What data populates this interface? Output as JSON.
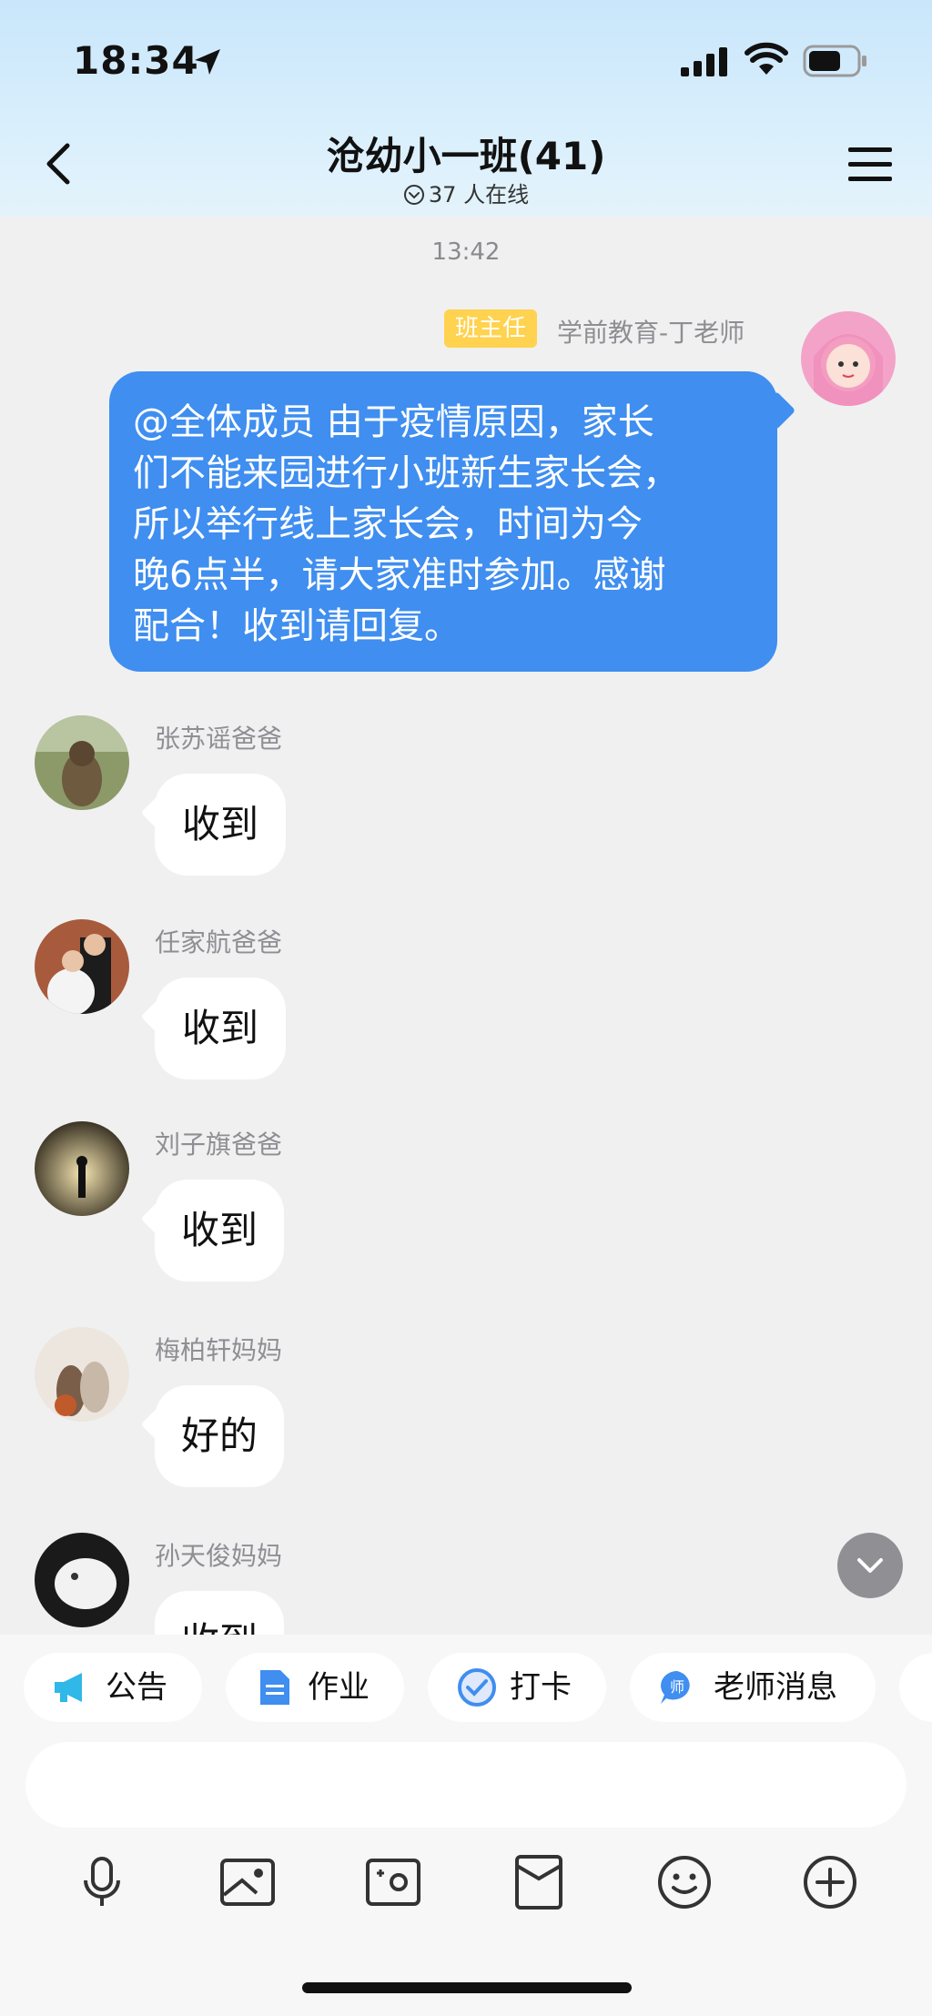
{
  "status_bar": {
    "time": "18:34"
  },
  "header": {
    "title": "沧幼小一班(41)",
    "online_text": "37 人在线"
  },
  "chat": {
    "timestamp": "13:42",
    "teacher_message": {
      "badge": "班主任",
      "sender": "学前教育-丁老师",
      "lines": [
        "@全体成员 由于疫情原因，家长",
        "们不能来园进行小班新生家长会，",
        "所以举行线上家长会，时间为今",
        "晚6点半，请大家准时参加。感谢",
        "配合！收到请回复。"
      ]
    },
    "replies": [
      {
        "sender": "张苏谣爸爸",
        "text": "收到"
      },
      {
        "sender": "任家航爸爸",
        "text": "收到"
      },
      {
        "sender": "刘子旗爸爸",
        "text": "收到"
      },
      {
        "sender": "梅柏轩妈妈",
        "text": "好的"
      },
      {
        "sender": "孙天俊妈妈",
        "text": "收到"
      }
    ]
  },
  "shortcuts": [
    {
      "label": "公告",
      "icon": "megaphone-icon"
    },
    {
      "label": "作业",
      "icon": "document-icon"
    },
    {
      "label": "打卡",
      "icon": "checkin-icon"
    },
    {
      "label": "老师消息",
      "icon": "teacher-message-icon"
    }
  ],
  "input": {
    "placeholder": ""
  },
  "toolbar_icons": [
    "microphone-icon",
    "image-icon",
    "camera-icon",
    "red-packet-icon",
    "emoji-icon",
    "plus-icon"
  ],
  "colors": {
    "header_bg": "#c9e6fb",
    "teacher_bubble": "#3f8ef0",
    "badge": "#ffd24f",
    "page_bg": "#f0f0f1"
  }
}
